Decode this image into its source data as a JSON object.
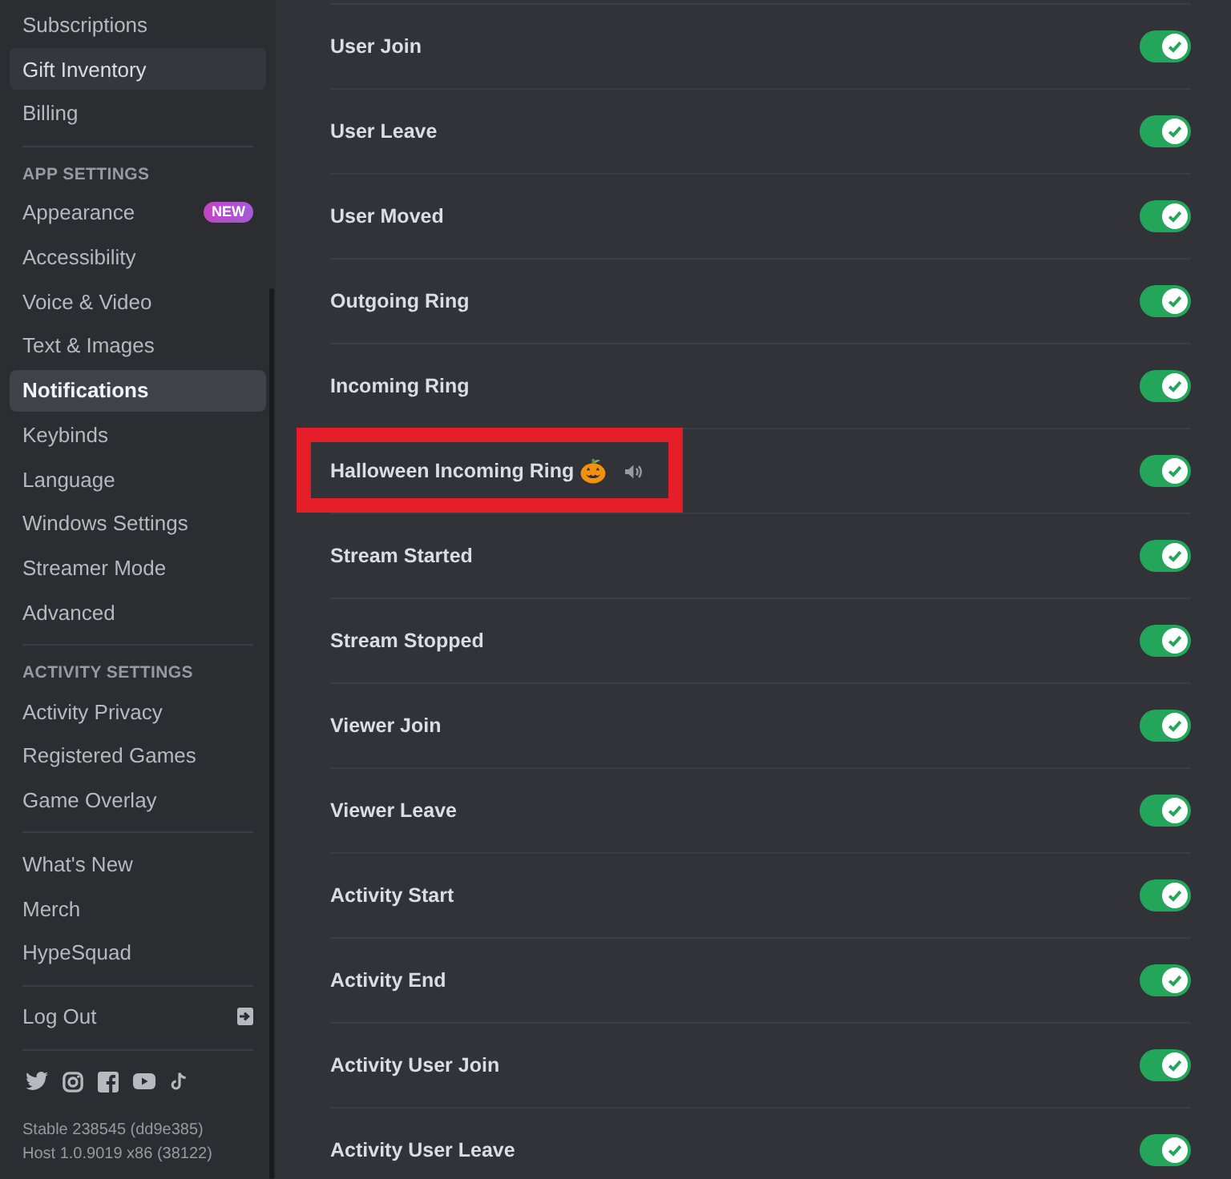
{
  "sidebar": {
    "groups": [
      {
        "items": [
          {
            "label": "Subscriptions",
            "selected": false,
            "hovered": false
          },
          {
            "label": "Gift Inventory",
            "selected": false,
            "hovered": true
          },
          {
            "label": "Billing",
            "selected": false,
            "hovered": false
          }
        ]
      },
      {
        "header": "APP SETTINGS",
        "items": [
          {
            "label": "Appearance",
            "badge": "NEW",
            "selected": false,
            "hovered": false
          },
          {
            "label": "Accessibility",
            "selected": false,
            "hovered": false
          },
          {
            "label": "Voice & Video",
            "selected": false,
            "hovered": false
          },
          {
            "label": "Text & Images",
            "selected": false,
            "hovered": false
          },
          {
            "label": "Notifications",
            "selected": true,
            "hovered": false
          },
          {
            "label": "Keybinds",
            "selected": false,
            "hovered": false
          },
          {
            "label": "Language",
            "selected": false,
            "hovered": false
          },
          {
            "label": "Windows Settings",
            "selected": false,
            "hovered": false
          },
          {
            "label": "Streamer Mode",
            "selected": false,
            "hovered": false
          },
          {
            "label": "Advanced",
            "selected": false,
            "hovered": false
          }
        ]
      },
      {
        "header": "ACTIVITY SETTINGS",
        "items": [
          {
            "label": "Activity Privacy",
            "selected": false,
            "hovered": false
          },
          {
            "label": "Registered Games",
            "selected": false,
            "hovered": false
          },
          {
            "label": "Game Overlay",
            "selected": false,
            "hovered": false
          }
        ]
      },
      {
        "items": [
          {
            "label": "What's New",
            "selected": false,
            "hovered": false
          },
          {
            "label": "Merch",
            "selected": false,
            "hovered": false
          },
          {
            "label": "HypeSquad",
            "selected": false,
            "hovered": false
          }
        ]
      }
    ],
    "log_out": {
      "label": "Log Out"
    },
    "version": [
      "Stable 238545 (dd9e385)",
      "Host 1.0.9019 x86 (38122)"
    ]
  },
  "sounds": {
    "rows": [
      {
        "label": "User Join",
        "kind": "standard",
        "on": true,
        "highlighted": false
      },
      {
        "label": "User Leave",
        "kind": "standard",
        "on": true,
        "highlighted": false
      },
      {
        "label": "User Moved",
        "kind": "standard",
        "on": true,
        "highlighted": false
      },
      {
        "label": "Outgoing Ring",
        "kind": "standard",
        "on": true,
        "highlighted": false
      },
      {
        "label": "Incoming Ring",
        "kind": "standard",
        "on": true,
        "highlighted": false
      },
      {
        "label": "Halloween Incoming Ring",
        "kind": "seasonal",
        "on": true,
        "highlighted": true
      },
      {
        "label": "Stream Started",
        "kind": "standard",
        "on": true,
        "highlighted": false
      },
      {
        "label": "Stream Stopped",
        "kind": "standard",
        "on": true,
        "highlighted": false
      },
      {
        "label": "Viewer Join",
        "kind": "standard",
        "on": true,
        "highlighted": false
      },
      {
        "label": "Viewer Leave",
        "kind": "standard",
        "on": true,
        "highlighted": false
      },
      {
        "label": "Activity Start",
        "kind": "standard",
        "on": true,
        "highlighted": false
      },
      {
        "label": "Activity End",
        "kind": "standard",
        "on": true,
        "highlighted": false
      },
      {
        "label": "Activity User Join",
        "kind": "standard",
        "on": true,
        "highlighted": false
      },
      {
        "label": "Activity User Leave",
        "kind": "standard",
        "on": true,
        "highlighted": false
      }
    ]
  }
}
